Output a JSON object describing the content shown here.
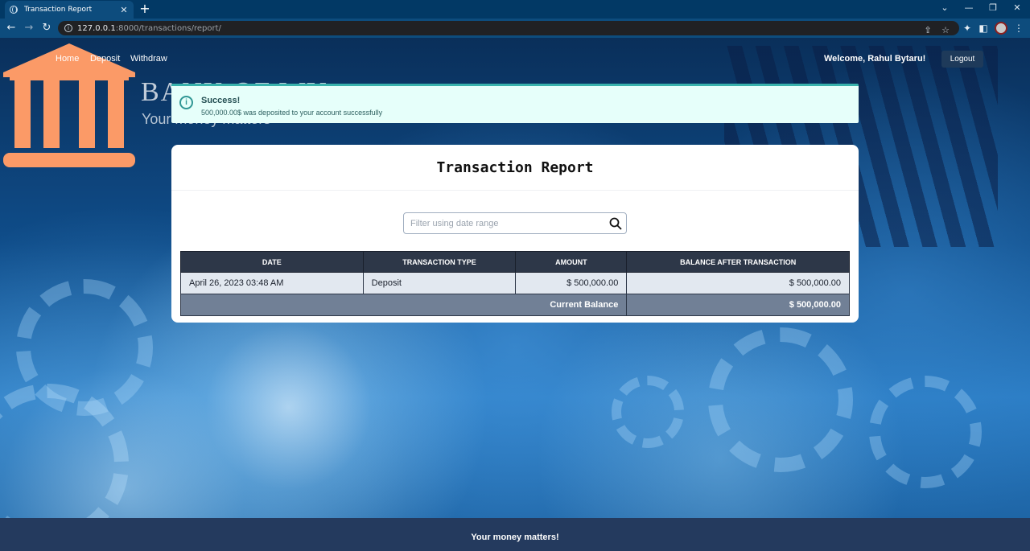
{
  "browser": {
    "tab_title": "Transaction Report",
    "tab_close": "✕",
    "new_tab": "+",
    "url_host": "127.0.0.1",
    "url_rest": ":8000/transactions/report/"
  },
  "nav": {
    "home": "Home",
    "deposit": "Deposit",
    "withdraw": "Withdraw",
    "welcome": "Welcome, Rahul Bytaru!",
    "logout": "Logout"
  },
  "logo": {
    "text": "BANK OF WY",
    "subtitle": "Your money matters"
  },
  "alert": {
    "icon": "i",
    "title": "Success!",
    "message": "500,000.00$ was deposited to your account successfully"
  },
  "report": {
    "title": "Transaction Report",
    "search_placeholder": "Filter using date range",
    "columns": [
      "DATE",
      "TRANSACTION TYPE",
      "AMOUNT",
      "BALANCE AFTER TRANSACTION"
    ],
    "rows": [
      {
        "date": "April 26, 2023 03:48 AM",
        "type": "Deposit",
        "amount": "$ 500,000.00",
        "balance": "$ 500,000.00"
      }
    ],
    "current_balance_label": "Current Balance",
    "current_balance": "$ 500,000.00"
  },
  "footer": {
    "text": "Your money matters!"
  },
  "colors": {
    "logo_orange": "#fb9a67",
    "alert_bg": "#e6fffa",
    "alert_accent": "#38b2ac",
    "table_header": "#2d3748",
    "footer_bg": "#243a5e"
  }
}
